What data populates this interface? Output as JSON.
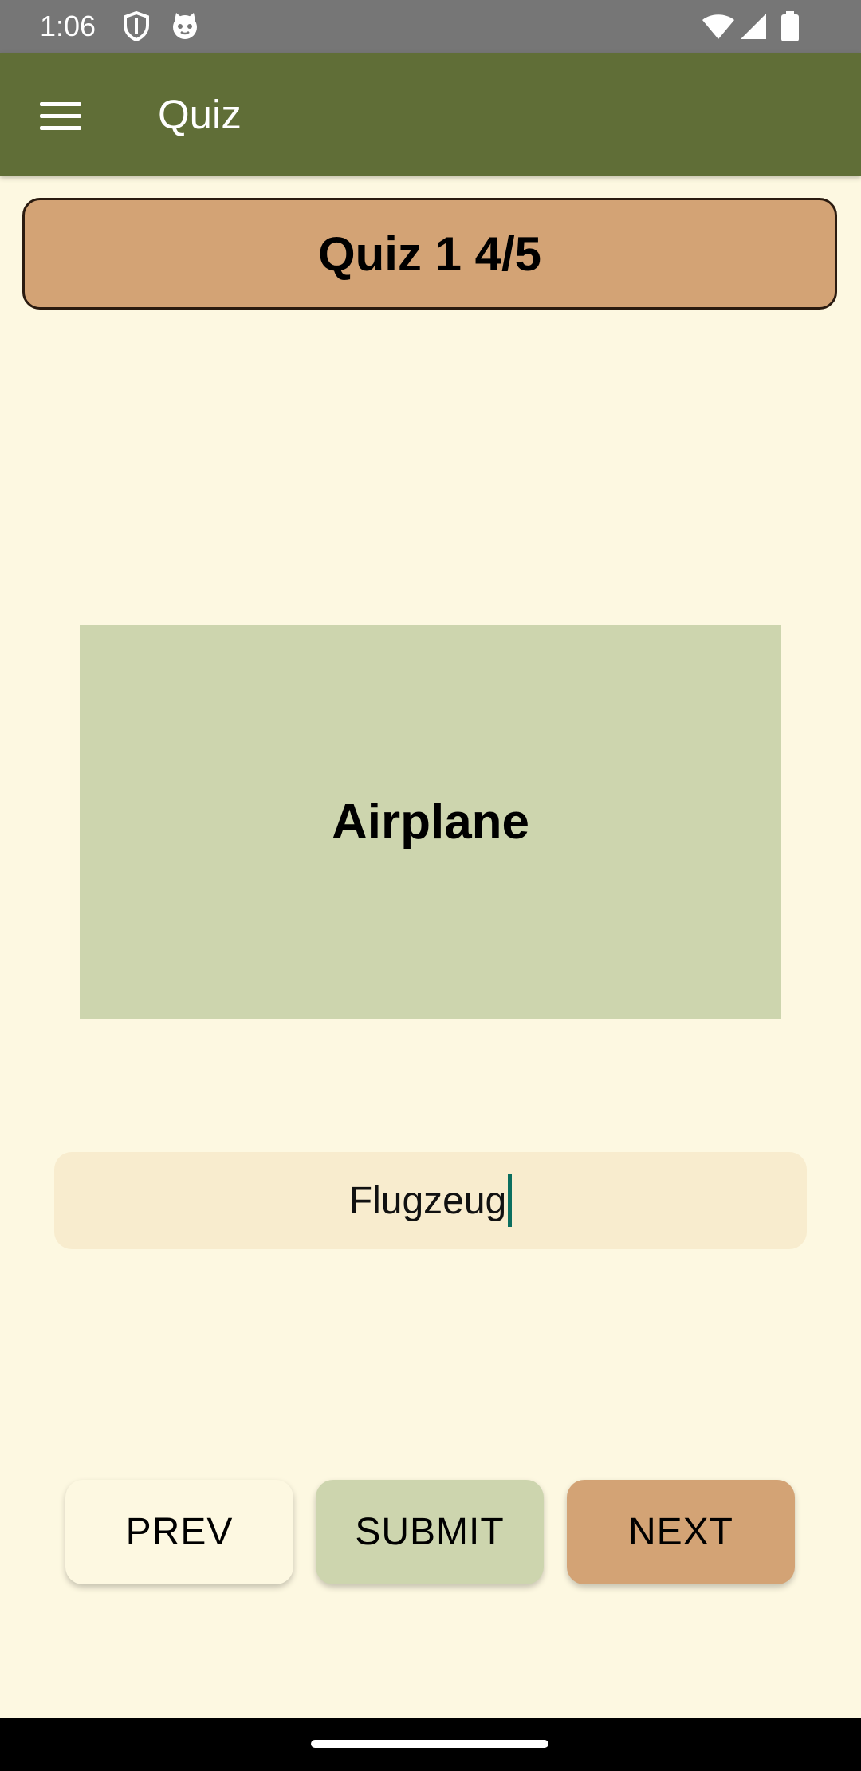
{
  "status_bar": {
    "time": "1:06",
    "icons": [
      "shield-icon",
      "cat-icon",
      "wifi-icon",
      "signal-icon",
      "battery-icon"
    ]
  },
  "app_bar": {
    "title": "Quiz",
    "menu_icon": "hamburger-menu-icon"
  },
  "quiz": {
    "header": "Quiz 1 4/5",
    "word": "Airplane",
    "answer_value": "Flugzeug"
  },
  "buttons": {
    "prev": "PREV",
    "submit": "SUBMIT",
    "next": "NEXT"
  },
  "colors": {
    "app_bar": "#606E37",
    "background": "#FDF8E1",
    "header_card": "#D3A375",
    "word_card": "#CDD5AE",
    "answer_field": "#F8ECCE",
    "status_bar": "#767676"
  }
}
